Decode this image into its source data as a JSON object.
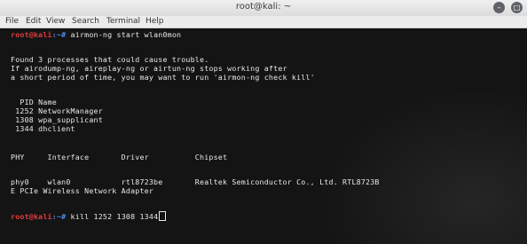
{
  "window": {
    "title": "root@kali: ~"
  },
  "menu": [
    "File",
    "Edit",
    "View",
    "Search",
    "Terminal",
    "Help"
  ],
  "prompt": {
    "user": "root@kali",
    "path": ":~#"
  },
  "lines": {
    "cmd1": " airmon-ng start wlan0mon",
    "l1": "Found 3 processes that could cause trouble.",
    "l2": "If airodump-ng, aireplay-ng or airtun-ng stops working after",
    "l3": "a short period of time, you may want to run 'airmon-ng check kill'",
    "l4": "  PID Name",
    "l5": " 1252 NetworkManager",
    "l6": " 1308 wpa_supplicant",
    "l7": " 1344 dhclient",
    "l8": "PHY     Interface       Driver          Chipset",
    "l9": "phy0    wlan0           rtl8723be       Realtek Semiconductor Co., Ltd. RTL8723B",
    "l10": "E PCIe Wireless Network Adapter",
    "cmd2": " kill 1252 1308 1344"
  }
}
